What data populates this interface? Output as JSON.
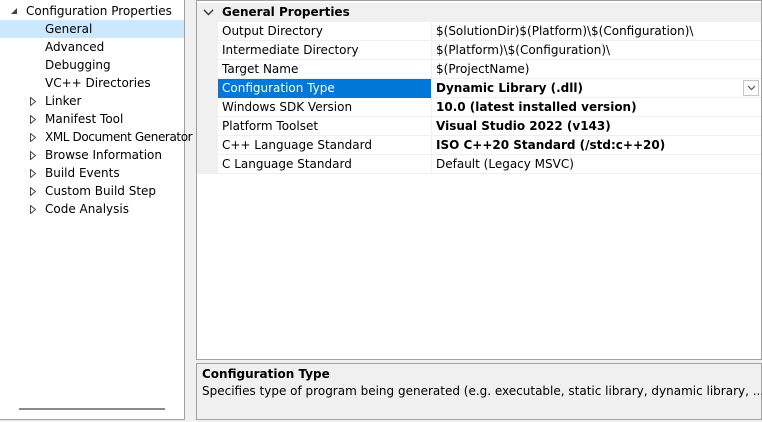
{
  "tree": {
    "root": {
      "label": "Configuration Properties",
      "icon": "expanded-triangle-icon"
    },
    "items": [
      {
        "label": "General",
        "selected": true,
        "expandable": false
      },
      {
        "label": "Advanced",
        "expandable": false
      },
      {
        "label": "Debugging",
        "expandable": false
      },
      {
        "label": "VC++ Directories",
        "expandable": false
      },
      {
        "label": "Linker",
        "expandable": true
      },
      {
        "label": "Manifest Tool",
        "expandable": true
      },
      {
        "label": "XML Document Generator",
        "expandable": true
      },
      {
        "label": "Browse Information",
        "expandable": true
      },
      {
        "label": "Build Events",
        "expandable": true
      },
      {
        "label": "Custom Build Step",
        "expandable": true
      },
      {
        "label": "Code Analysis",
        "expandable": true
      }
    ]
  },
  "grid": {
    "category": "General Properties",
    "rows": [
      {
        "name": "Output Directory",
        "value": "$(SolutionDir)$(Platform)\\$(Configuration)\\",
        "bold": false
      },
      {
        "name": "Intermediate Directory",
        "value": "$(Platform)\\$(Configuration)\\",
        "bold": false
      },
      {
        "name": "Target Name",
        "value": "$(ProjectName)",
        "bold": false
      },
      {
        "name": "Configuration Type",
        "value": "Dynamic Library (.dll)",
        "bold": true,
        "selected": true
      },
      {
        "name": "Windows SDK Version",
        "value": "10.0 (latest installed version)",
        "bold": true
      },
      {
        "name": "Platform Toolset",
        "value": "Visual Studio 2022 (v143)",
        "bold": true
      },
      {
        "name": "C++ Language Standard",
        "value": "ISO C++20 Standard (/std:c++20)",
        "bold": true
      },
      {
        "name": "C Language Standard",
        "value": "Default (Legacy MSVC)",
        "bold": false
      }
    ]
  },
  "description": {
    "title": "Configuration Type",
    "text": "Specifies type of program being generated (e.g. executable, static library, dynamic library, ...)."
  },
  "colors": {
    "selection_highlight": "#0078d7",
    "tree_selection": "#cce8ff",
    "pane_background": "#f0f0f0"
  }
}
